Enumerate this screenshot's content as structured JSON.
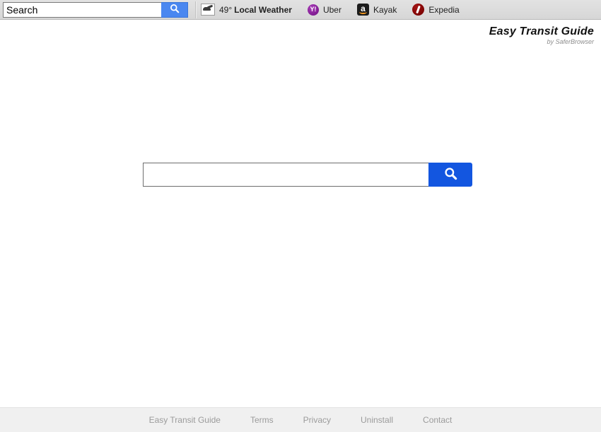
{
  "toolbar": {
    "search": {
      "value": "Search",
      "placeholder": "Search",
      "button_icon": "search-icon"
    },
    "items": [
      {
        "id": "local-weather",
        "icon": "weather-cloud-icon",
        "temperature": "49°",
        "label": "Local Weather"
      },
      {
        "id": "uber",
        "icon": "uber-circle-icon",
        "icon_glyph": "Y!",
        "label": "Uber"
      },
      {
        "id": "kayak",
        "icon": "amazon-a-icon",
        "icon_glyph": "a",
        "label": "Kayak"
      },
      {
        "id": "expedia",
        "icon": "expedia-circle-icon",
        "label": "Expedia"
      }
    ]
  },
  "brand": {
    "title": "Easy Transit Guide",
    "subtitle": "by SaferBrowser"
  },
  "main": {
    "search": {
      "value": "",
      "placeholder": "",
      "button_icon": "search-icon"
    }
  },
  "footer": {
    "links": [
      {
        "label": "Easy Transit Guide"
      },
      {
        "label": "Terms"
      },
      {
        "label": "Privacy"
      },
      {
        "label": "Uninstall"
      },
      {
        "label": "Contact"
      }
    ]
  },
  "colors": {
    "toolbar_button_blue": "#4a87f0",
    "main_button_blue": "#1356e0",
    "toolbar_bg": "#dcdcdc",
    "footer_bg": "#f0f0f0",
    "footer_link": "#9b9b9b",
    "uber_purple": "#8b1f9e",
    "expedia_red": "#a31616",
    "amazon_orange": "#f59a23"
  }
}
